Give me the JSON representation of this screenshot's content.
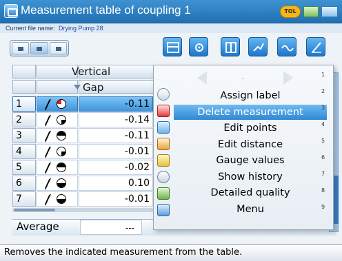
{
  "window": {
    "title": "Measurement table of coupling 1",
    "tol_badge": "TOL"
  },
  "file": {
    "label": "Current file name:",
    "name": "Drying Pump 28"
  },
  "table": {
    "header_group": "Vertical",
    "header_column": "Gap",
    "rows": [
      {
        "num": "1",
        "value": "-0.11",
        "selected": true
      },
      {
        "num": "2",
        "value": "-0.14"
      },
      {
        "num": "3",
        "value": "-0.11"
      },
      {
        "num": "4",
        "value": "-0.01"
      },
      {
        "num": "5",
        "value": "-0.02"
      },
      {
        "num": "6",
        "value": "0.10"
      },
      {
        "num": "7",
        "value": "-0.01"
      }
    ],
    "average_label": "Average",
    "average_value": "---"
  },
  "menu": {
    "nav_mid": "-",
    "items": [
      "Assign label",
      "Delete measurement",
      "Edit points",
      "Edit distance",
      "Gauge values",
      "Show history",
      "Detailed quality",
      "Menu"
    ],
    "highlighted_index": 1,
    "side_numbers": [
      "1",
      "2",
      "3",
      "4",
      "5",
      "6",
      "7",
      "8",
      "9"
    ]
  },
  "status": {
    "text": "Removes the indicated measurement from the table."
  },
  "colors": {
    "titlebar": "#2a80c4",
    "highlight": "#3f95da",
    "tol": "#f3b71d"
  },
  "icons": {
    "toolbar": [
      "table-icon",
      "settings-icon",
      "tolerance-icon",
      "measure-icon",
      "wave-icon",
      "line-chart-icon"
    ]
  }
}
